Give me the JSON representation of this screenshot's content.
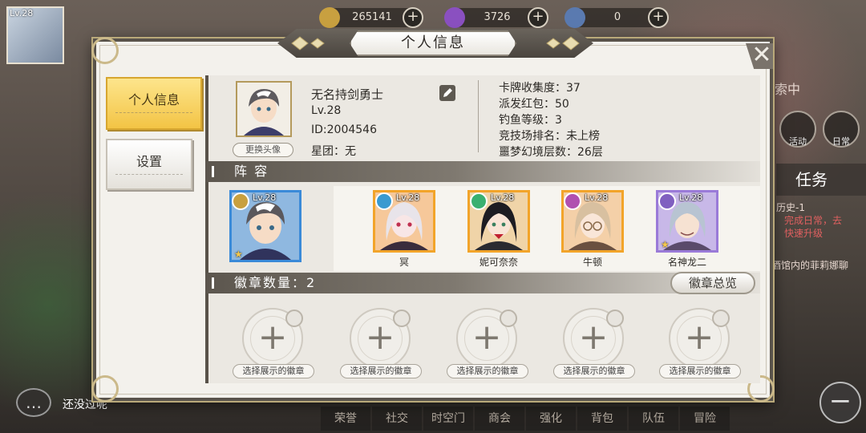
{
  "background": {
    "player_level": "Lv.28",
    "currencies": [
      {
        "name": "gold",
        "value": "265141",
        "color": "#c8a040"
      },
      {
        "name": "crystal",
        "value": "3726",
        "color": "#8a50c0"
      },
      {
        "name": "orb",
        "value": "0",
        "color": "#5a7ab0"
      }
    ],
    "side_buttons": [
      "活动",
      "日常"
    ],
    "task_label": "任务",
    "fragments": [
      "索中",
      "历史-1",
      "完成日常，去",
      "快速升级",
      "酒馆内的菲莉娜聊"
    ],
    "bottom_nav": [
      "荣誉",
      "社交",
      "时空门",
      "商会",
      "强化",
      "背包",
      "队伍",
      "冒险"
    ],
    "chat_text": "还没过呢"
  },
  "dialog": {
    "title": "个人信息",
    "tabs": [
      {
        "label": "个人信息",
        "active": true
      },
      {
        "label": "设置",
        "active": false
      }
    ],
    "profile": {
      "change_avatar_label": "更换头像",
      "name": "无名持剑勇士",
      "level": "Lv.28",
      "id": "ID:2004546",
      "guild": "星团：无"
    },
    "stats": [
      "卡牌收集度：37",
      "派发红包：50",
      "钓鱼等级：3",
      "竞技场排名：未上榜",
      "噩梦幻境层数：26层"
    ],
    "team": {
      "section_title": "阵 容",
      "leader": {
        "level": "Lv.28",
        "class_color": "#c8a040"
      },
      "members": [
        {
          "name": "冥",
          "level": "Lv.28",
          "class_color": "#3a9ad0",
          "hair": "#e8e4ea",
          "frame": "#f2a42a"
        },
        {
          "name": "妮可奈奈",
          "level": "Lv.28",
          "class_color": "#3ab070",
          "hair": "#1d1c22",
          "frame": "#f2a42a"
        },
        {
          "name": "牛顿",
          "level": "Lv.28",
          "class_color": "#b050b0",
          "hair": "#d8c0a0",
          "frame": "#f2a42a"
        },
        {
          "name": "名神龙二",
          "level": "Lv.28",
          "class_color": "#8060c0",
          "hair": "#b8c4d2",
          "frame": "#9a7ad8"
        }
      ]
    },
    "badges": {
      "section_title": "徽章数量：2",
      "overview_label": "徽章总览",
      "slots": [
        {
          "label": "选择展示的徽章"
        },
        {
          "label": "选择展示的徽章"
        },
        {
          "label": "选择展示的徽章"
        },
        {
          "label": "选择展示的徽章"
        },
        {
          "label": "选择展示的徽章"
        }
      ]
    }
  }
}
